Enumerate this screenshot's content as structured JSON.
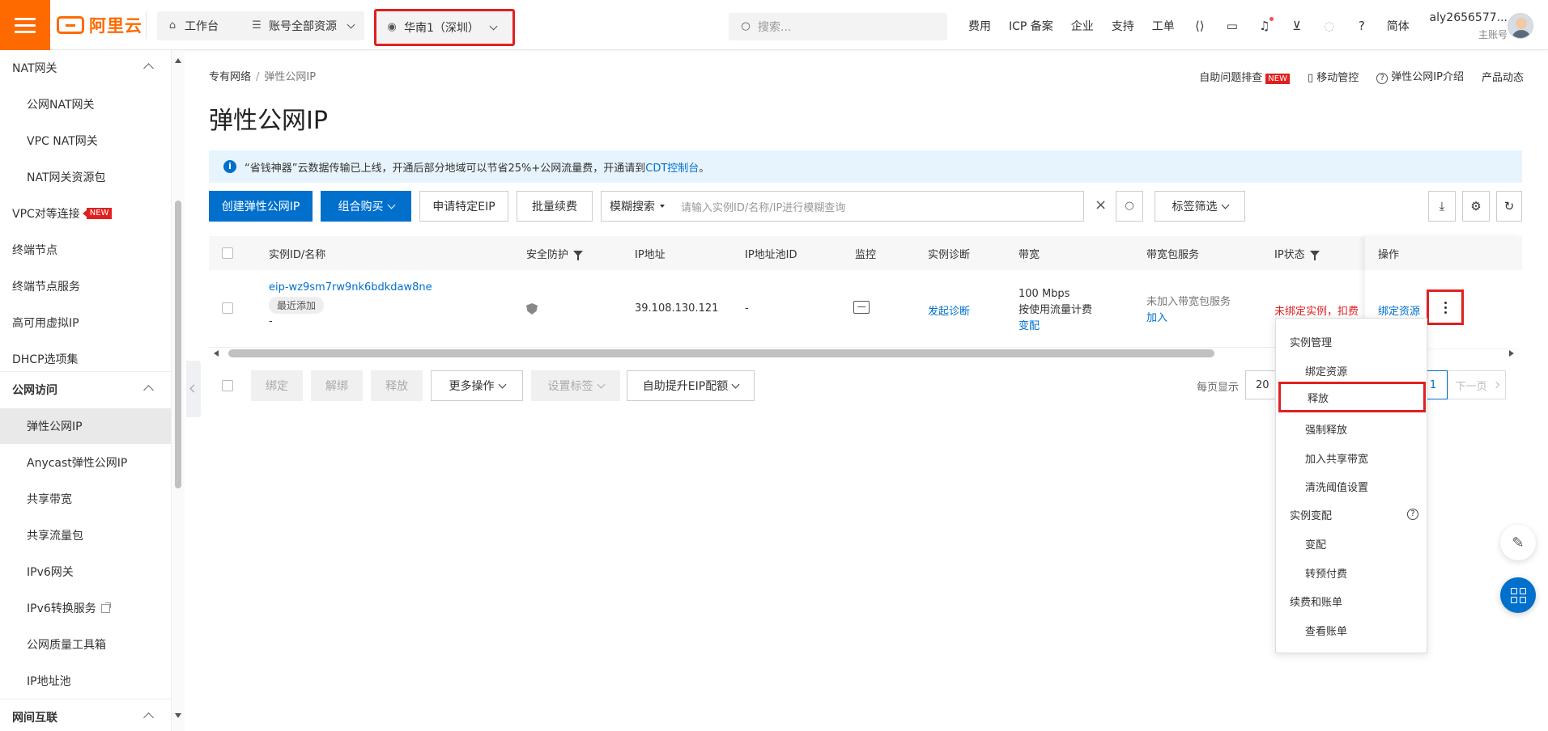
{
  "topbar": {
    "logo_text": "阿里云",
    "workbench": "工作台",
    "resources": "账号全部资源",
    "region": "华南1（深圳）",
    "search_placeholder": "搜索...",
    "nav": [
      "费用",
      "ICP 备案",
      "企业",
      "支持",
      "工单"
    ],
    "lang": "简体",
    "account_name": "aly2656577...",
    "account_role": "主账号"
  },
  "sidebar": {
    "items": [
      {
        "label": "NAT网关"
      },
      {
        "label": "公网NAT网关"
      },
      {
        "label": "VPC NAT网关"
      },
      {
        "label": "NAT网关资源包"
      },
      {
        "label": "VPC对等连接",
        "badge": "NEW"
      },
      {
        "label": "终端节点"
      },
      {
        "label": "终端节点服务"
      },
      {
        "label": "高可用虚拟IP"
      },
      {
        "label": "DHCP选项集"
      },
      {
        "label": "公网访问"
      },
      {
        "label": "弹性公网IP"
      },
      {
        "label": "Anycast弹性公网IP"
      },
      {
        "label": "共享带宽"
      },
      {
        "label": "共享流量包"
      },
      {
        "label": "IPv6网关"
      },
      {
        "label": "IPv6转换服务"
      },
      {
        "label": "公网质量工具箱"
      },
      {
        "label": "IP地址池"
      },
      {
        "label": "网间互联"
      }
    ]
  },
  "main": {
    "breadcrumb": {
      "parent": "专有网络",
      "sep": "/",
      "current": "弹性公网IP"
    },
    "title": "弹性公网IP",
    "help_links": {
      "troubleshoot": "自助问题排查",
      "new": "NEW",
      "mobile": "移动管控",
      "intro": "弹性公网IP介绍",
      "news": "产品动态"
    },
    "notice": {
      "text": "“省钱神器”云数据传输已上线，开通后部分地域可以节省25%+公网流量费，开通请到",
      "link": "CDT控制台",
      "tail": "。"
    },
    "toolbar": {
      "create": "创建弹性公网IP",
      "combo": "组合购买",
      "apply": "申请特定EIP",
      "renew": "批量续费",
      "filter_mode": "模糊搜索",
      "filter_placeholder": "请输入实例ID/名称/IP进行模糊查询",
      "tag_filter": "标签筛选"
    },
    "table": {
      "headers": [
        "实例ID/名称",
        "安全防护",
        "IP地址",
        "IP地址池ID",
        "监控",
        "实例诊断",
        "带宽",
        "带宽包服务",
        "IP状态",
        "操作"
      ],
      "row": {
        "id": "eip-wz9sm7rw9nk6bdkdaw8ne",
        "tag": "最近添加",
        "name": "-",
        "ip": "39.108.130.121",
        "pool": "-",
        "diagnose": "发起诊断",
        "bandwidth": "100 Mbps",
        "billing": "按使用流量计费",
        "change": "变配",
        "pkg_status": "未加入带宽包服务",
        "pkg_join": "加入",
        "status": "未绑定实例，扣费",
        "action_bind": "绑定资源"
      }
    },
    "bulk": {
      "bind": "绑定",
      "unbind": "解绑",
      "release": "释放",
      "more": "更多操作",
      "tags": "设置标签",
      "quota": "自助提升EIP配额"
    },
    "pager": {
      "label": "每页显示",
      "size": "20",
      "current": "1",
      "next": "下一页"
    }
  },
  "dropdown": {
    "items": [
      {
        "label": "实例管理",
        "type": "group"
      },
      {
        "label": "绑定资源",
        "type": "option"
      },
      {
        "label": "释放",
        "type": "option",
        "highlight": true
      },
      {
        "label": "强制释放",
        "type": "option"
      },
      {
        "label": "加入共享带宽",
        "type": "option"
      },
      {
        "label": "清洗阈值设置",
        "type": "option"
      },
      {
        "label": "实例变配",
        "type": "group",
        "help": true
      },
      {
        "label": "变配",
        "type": "option"
      },
      {
        "label": "转预付费",
        "type": "option"
      },
      {
        "label": "续费和账单",
        "type": "group"
      },
      {
        "label": "查看账单",
        "type": "option"
      }
    ]
  },
  "colors": {
    "brand": "#ff6a00",
    "primary": "#0070cc",
    "highlight_border": "#e02020"
  }
}
